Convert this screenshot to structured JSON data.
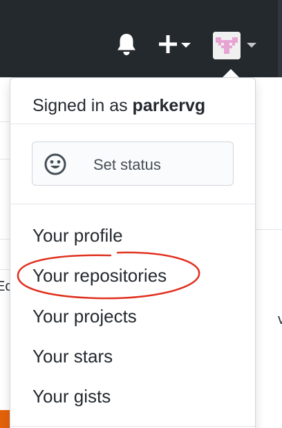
{
  "header": {
    "notifications_icon": "bell-icon",
    "create_icon": "plus-icon",
    "avatar_icon": "identicon-avatar",
    "colors": {
      "bar": "#24292e",
      "identicon": "#e7a4d3"
    }
  },
  "background": {
    "fragment_left": "Ec",
    "fragment_right": "v"
  },
  "dropdown": {
    "signed_in_prefix": "Signed in as ",
    "username": "parkervg",
    "set_status_icon": "smiley-icon",
    "set_status_label": "Set status",
    "menu_items": [
      {
        "label": "Your profile"
      },
      {
        "label": "Your repositories",
        "highlighted": true
      },
      {
        "label": "Your projects"
      },
      {
        "label": "Your stars"
      },
      {
        "label": "Your gists"
      }
    ],
    "annotation_color": "#e0301e"
  }
}
